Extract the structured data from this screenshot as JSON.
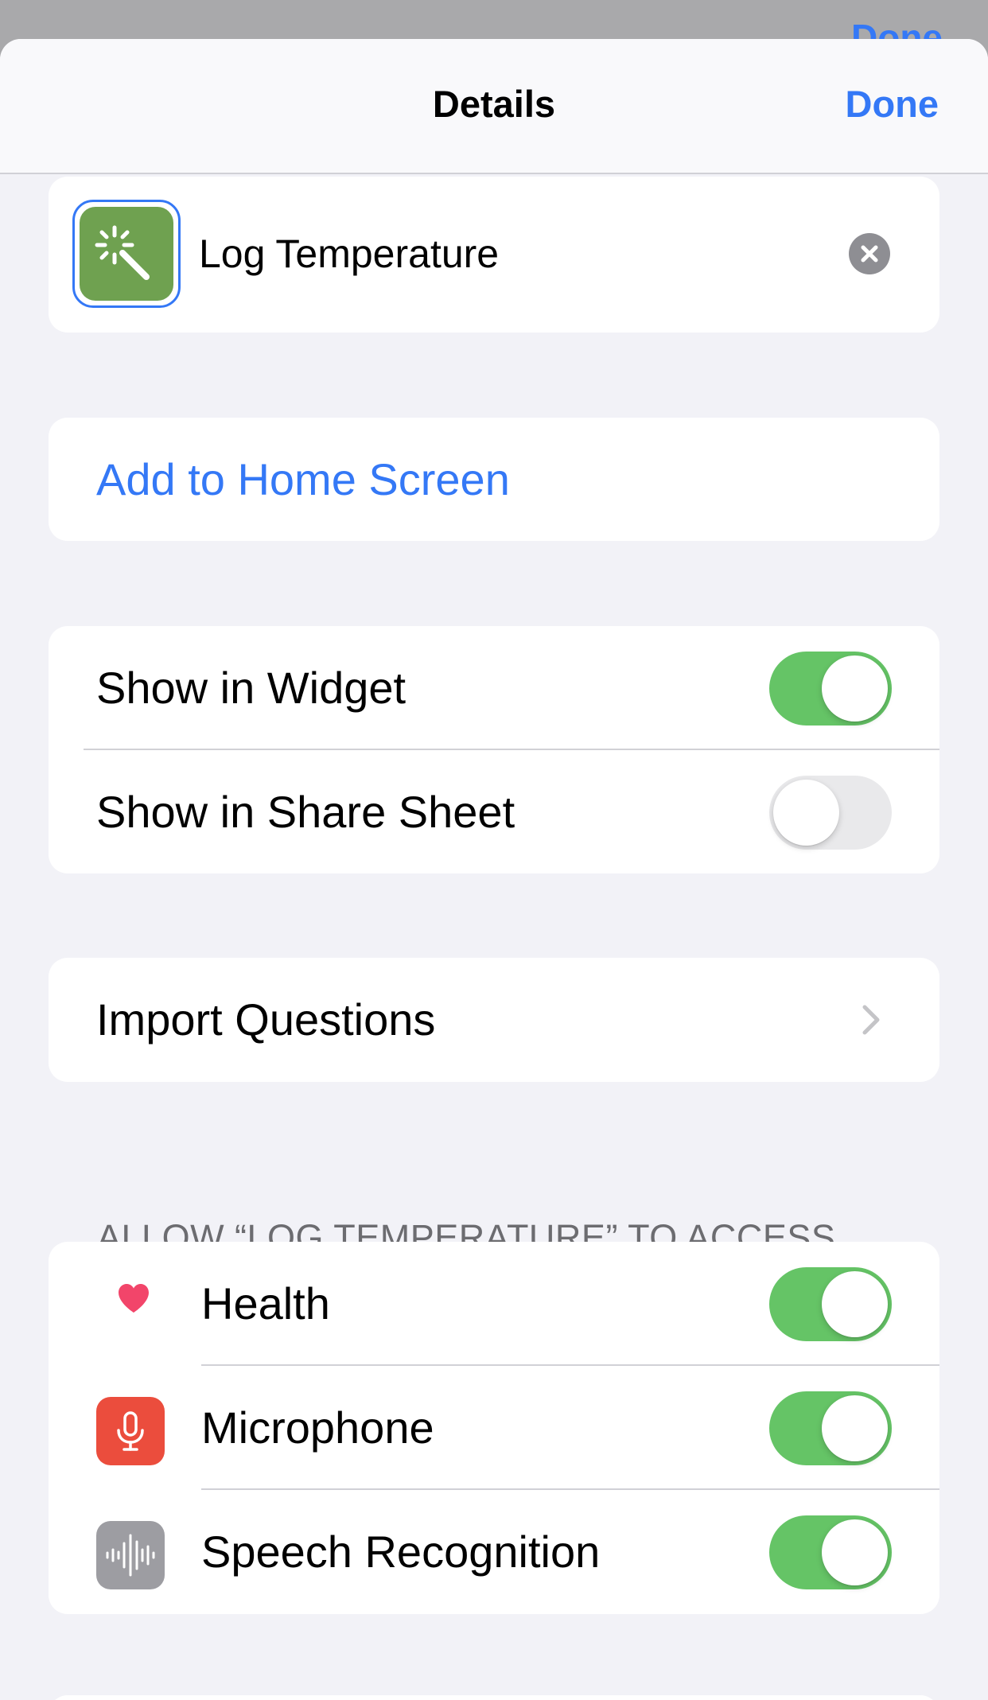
{
  "background_sheet": {
    "done_label": "Done"
  },
  "navbar": {
    "title": "Details",
    "done_label": "Done"
  },
  "shortcut": {
    "name": "Log Temperature",
    "icon_color": "#6fa150",
    "icon": "magic-wand-icon"
  },
  "home_screen": {
    "label": "Add to Home Screen"
  },
  "visibility": {
    "items": [
      {
        "label": "Show in Widget",
        "on": true
      },
      {
        "label": "Show in Share Sheet",
        "on": false
      }
    ]
  },
  "import": {
    "label": "Import Questions"
  },
  "access": {
    "header": "ALLOW “LOG TEMPERATURE” TO ACCESS",
    "items": [
      {
        "label": "Health",
        "icon": "heart-icon",
        "on": true
      },
      {
        "label": "Microphone",
        "icon": "microphone-icon",
        "on": true
      },
      {
        "label": "Speech Recognition",
        "icon": "waveform-icon",
        "on": true
      }
    ]
  },
  "colors": {
    "accent": "#3478f6",
    "toggle_on": "#65c466",
    "toggle_off": "#e9e9eb",
    "health": "#f2456a",
    "microphone": "#eb4d3d",
    "speech": "#9d9da2"
  }
}
